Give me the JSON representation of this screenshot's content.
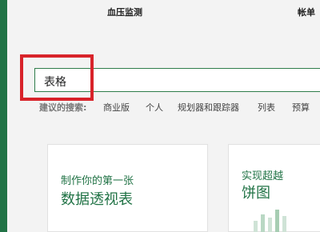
{
  "top_bar": {
    "label1": "血压监测",
    "label2": "帐单"
  },
  "search": {
    "value": "表格"
  },
  "suggestions": {
    "label": "建议的搜索:",
    "items": [
      "商业版",
      "个人",
      "规划器和跟踪器",
      "列表",
      "预算"
    ]
  },
  "cards": [
    {
      "line1": "制作你的第一张",
      "line2": "数据透视表"
    },
    {
      "line1": "实现超越",
      "line2": "饼图"
    }
  ],
  "colors": {
    "accent": "#217346",
    "highlight": "#d8232a"
  }
}
